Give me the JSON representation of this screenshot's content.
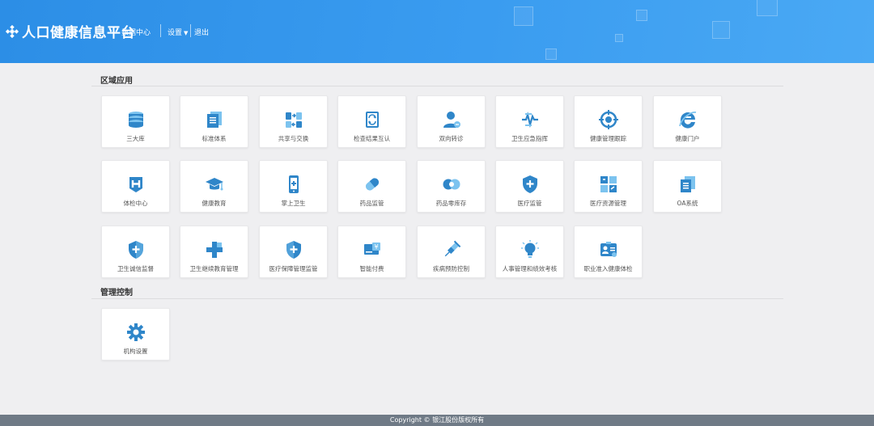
{
  "header": {
    "brand_title": "人口健康信息平台",
    "data_center": "数据中心",
    "settings_label": "设置",
    "logout_label": "退出"
  },
  "sections": [
    {
      "title": "区域应用"
    },
    {
      "title": "管理控制"
    }
  ],
  "tiles": [
    {
      "label": "三大库",
      "icon": "database-stack-icon"
    },
    {
      "label": "标准体系",
      "icon": "document-stack-icon"
    },
    {
      "label": "共享与交换",
      "icon": "exchange-icon"
    },
    {
      "label": "检查结果互认",
      "icon": "sync-doc-icon"
    },
    {
      "label": "双向转诊",
      "icon": "patient-transfer-icon"
    },
    {
      "label": "卫生应急指挥",
      "icon": "emergency-pulse-icon"
    },
    {
      "label": "健康管理跟踪",
      "icon": "target-icon"
    },
    {
      "label": "健康门户",
      "icon": "ie-browser-icon"
    },
    {
      "label": "体检中心",
      "icon": "hospital-h-icon"
    },
    {
      "label": "健康教育",
      "icon": "graduation-cap-icon"
    },
    {
      "label": "掌上卫生",
      "icon": "mobile-medical-icon"
    },
    {
      "label": "药品监管",
      "icon": "pill-icon"
    },
    {
      "label": "药品零库存",
      "icon": "capsule-ring-icon"
    },
    {
      "label": "医疗监管",
      "icon": "shield-cross-icon"
    },
    {
      "label": "医疗资源管理",
      "icon": "resource-grid-icon"
    },
    {
      "label": "OA系统",
      "icon": "oa-document-icon"
    },
    {
      "label": "卫生诚信监督",
      "icon": "shield-check-icon"
    },
    {
      "label": "卫生继续教育管理",
      "icon": "medical-cross-icon"
    },
    {
      "label": "医疗保障管理监管",
      "icon": "shield-plus-icon"
    },
    {
      "label": "智能付费",
      "icon": "payment-ticket-icon"
    },
    {
      "label": "疾病预防控制",
      "icon": "syringe-icon"
    },
    {
      "label": "人事管理和绩效考核",
      "icon": "lightbulb-icon"
    },
    {
      "label": "职业准入健康体检",
      "icon": "id-card-icon"
    },
    {
      "label": "机构设置",
      "icon": "gear-icon"
    }
  ],
  "footer": {
    "copyright": "Copyright © 银江股份版权所有"
  },
  "colors": {
    "header": "#3a9cf0",
    "icon": "#2f86c9",
    "icon_light": "#7cc3ef",
    "footer": "#6f7a86"
  }
}
